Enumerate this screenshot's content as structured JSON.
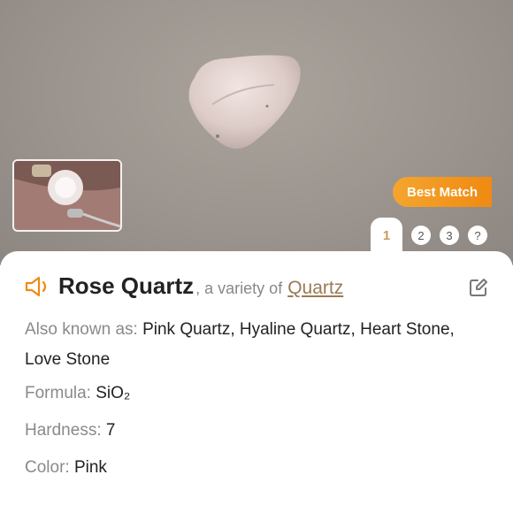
{
  "header": {
    "best_match": "Best Match"
  },
  "tabs": [
    "1",
    "2",
    "3",
    "?"
  ],
  "result": {
    "name": "Rose Quartz",
    "variety_prefix": ", a variety of",
    "variety": "Quartz",
    "aka_label": "Also known as:",
    "aka_value": "Pink Quartz, Hyaline Quartz, Heart Stone, Love Stone",
    "formula_label": "Formula:",
    "formula_value": "SiO₂",
    "hardness_label": "Hardness:",
    "hardness_value": "7",
    "color_label": "Color:",
    "color_value": "Pink"
  },
  "colors": {
    "accent": "#f08a12",
    "link": "#9b7a55",
    "tab_active": "#c79b5e"
  },
  "icons": [
    "speaker-icon",
    "edit-icon"
  ]
}
